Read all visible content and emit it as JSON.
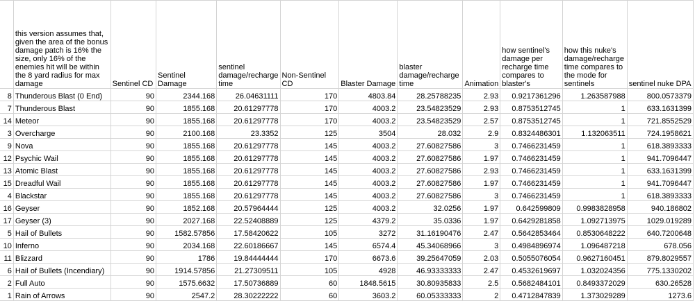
{
  "headers": [
    "",
    "this version assumes that, given the area of the bonus damage patch is 16% the size, only 16% of the enemies hit will be within the 8 yard radius for max damage",
    "Sentinel CD",
    "Sentinel Damage",
    "sentinel damage/recharge time",
    "Non-Sentinel CD",
    "Blaster Damage",
    "blaster damage/recharge time",
    "Animation",
    "how sentinel's damage per recharge time compares to blaster's",
    "how this nuke's damage/recharge time compares to the mode for sentinels",
    "sentinel nuke DPA"
  ],
  "rows": [
    [
      "8",
      "Thunderous Blast (0 End)",
      "90",
      "2344.168",
      "26.04631111",
      "170",
      "4803.84",
      "28.25788235",
      "2.93",
      "0.9217361296",
      "1.263587988",
      "800.0573379"
    ],
    [
      "7",
      "Thunderous Blast",
      "90",
      "1855.168",
      "20.61297778",
      "170",
      "4003.2",
      "23.54823529",
      "2.93",
      "0.8753512745",
      "1",
      "633.1631399"
    ],
    [
      "14",
      "Meteor",
      "90",
      "1855.168",
      "20.61297778",
      "170",
      "4003.2",
      "23.54823529",
      "2.57",
      "0.8753512745",
      "1",
      "721.8552529"
    ],
    [
      "3",
      "Overcharge",
      "90",
      "2100.168",
      "23.3352",
      "125",
      "3504",
      "28.032",
      "2.9",
      "0.8324486301",
      "1.132063511",
      "724.1958621"
    ],
    [
      "9",
      "Nova",
      "90",
      "1855.168",
      "20.61297778",
      "145",
      "4003.2",
      "27.60827586",
      "3",
      "0.7466231459",
      "1",
      "618.3893333"
    ],
    [
      "12",
      "Psychic Wail",
      "90",
      "1855.168",
      "20.61297778",
      "145",
      "4003.2",
      "27.60827586",
      "1.97",
      "0.7466231459",
      "1",
      "941.7096447"
    ],
    [
      "13",
      "Atomic Blast",
      "90",
      "1855.168",
      "20.61297778",
      "145",
      "4003.2",
      "27.60827586",
      "2.93",
      "0.7466231459",
      "1",
      "633.1631399"
    ],
    [
      "15",
      "Dreadful Wail",
      "90",
      "1855.168",
      "20.61297778",
      "145",
      "4003.2",
      "27.60827586",
      "1.97",
      "0.7466231459",
      "1",
      "941.7096447"
    ],
    [
      "4",
      "Blackstar",
      "90",
      "1855.168",
      "20.61297778",
      "145",
      "4003.2",
      "27.60827586",
      "3",
      "0.7466231459",
      "1",
      "618.3893333"
    ],
    [
      "16",
      "Geyser",
      "90",
      "1852.168",
      "20.57964444",
      "125",
      "4003.2",
      "32.0256",
      "1.97",
      "0.642599809",
      "0.9983828958",
      "940.186802"
    ],
    [
      "17",
      "Geyser (3)",
      "90",
      "2027.168",
      "22.52408889",
      "125",
      "4379.2",
      "35.0336",
      "1.97",
      "0.6429281858",
      "1.092713975",
      "1029.019289"
    ],
    [
      "5",
      "Hail of Bullets",
      "90",
      "1582.57856",
      "17.58420622",
      "105",
      "3272",
      "31.16190476",
      "2.47",
      "0.5642853464",
      "0.8530648222",
      "640.7200648"
    ],
    [
      "10",
      "Inferno",
      "90",
      "2034.168",
      "22.60186667",
      "145",
      "6574.4",
      "45.34068966",
      "3",
      "0.4984896974",
      "1.096487218",
      "678.056"
    ],
    [
      "11",
      "Blizzard",
      "90",
      "1786",
      "19.84444444",
      "170",
      "6673.6",
      "39.25647059",
      "2.03",
      "0.5055076054",
      "0.9627160451",
      "879.8029557"
    ],
    [
      "6",
      "Hail of Bullets (Incendiary)",
      "90",
      "1914.57856",
      "21.27309511",
      "105",
      "4928",
      "46.93333333",
      "2.47",
      "0.4532619697",
      "1.032024356",
      "775.1330202"
    ],
    [
      "2",
      "Full Auto",
      "90",
      "1575.6632",
      "17.50736889",
      "60",
      "1848.5615",
      "30.80935833",
      "2.5",
      "0.5682484101",
      "0.8493372029",
      "630.26528"
    ],
    [
      "1",
      "Rain of Arrows",
      "90",
      "2547.2",
      "28.30222222",
      "60",
      "3603.2",
      "60.05333333",
      "2",
      "0.4712847839",
      "1.373029289",
      "1273.6"
    ]
  ]
}
